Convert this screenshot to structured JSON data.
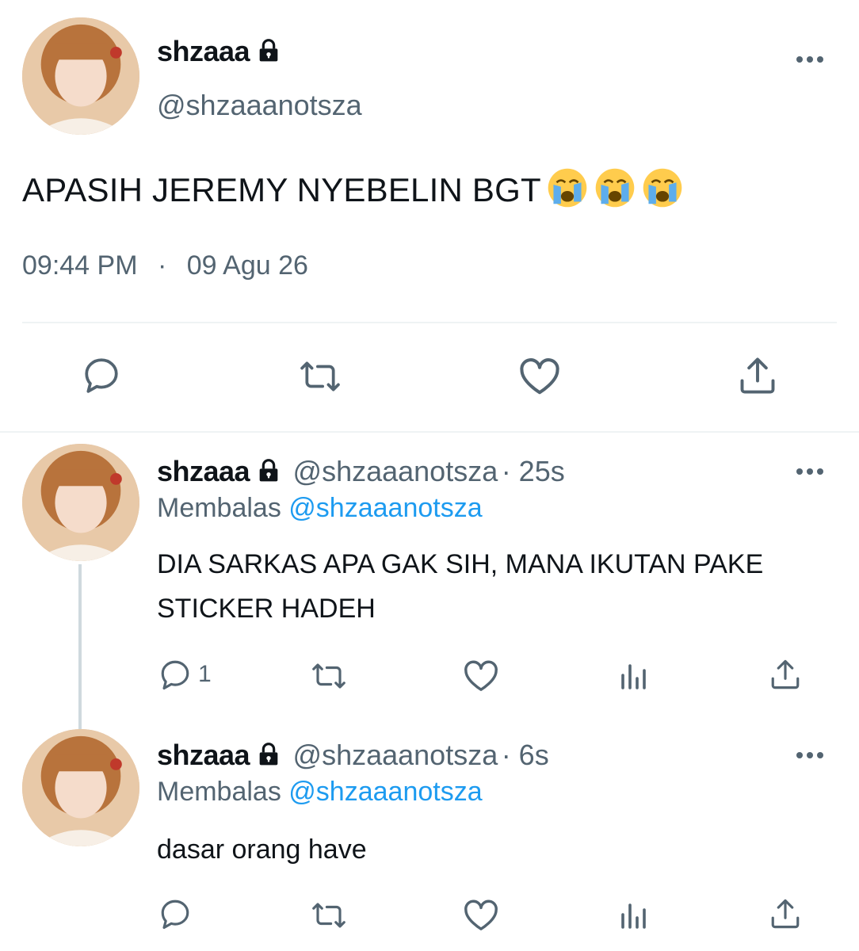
{
  "main_tweet": {
    "display_name": "shzaaa",
    "handle": "@shzaaanotsza",
    "text": "APASIH JEREMY NYEBELIN BGT",
    "emoji": [
      "loudly-crying-face",
      "loudly-crying-face",
      "loudly-crying-face"
    ],
    "time": "09:44 PM",
    "separator": "·",
    "date": "09 Agu 26",
    "actions": [
      "reply-icon",
      "retweet-icon",
      "like-icon",
      "share-icon"
    ]
  },
  "replies": [
    {
      "display_name": "shzaaa",
      "handle": "@shzaaanotsza",
      "age": "· 25s",
      "replying_prefix": "Membalas",
      "replying_to": "@shzaaanotsza",
      "text": "DIA SARKAS APA GAK SIH, MANA IKUTAN PAKE STICKER HADEH",
      "reply_count": "1"
    },
    {
      "display_name": "shzaaa",
      "handle": "@shzaaanotsza",
      "age": "· 6s",
      "replying_prefix": "Membalas",
      "replying_to": "@shzaaanotsza",
      "text": "dasar orang have",
      "reply_count": ""
    }
  ],
  "colors": {
    "primary_text": "#0f1419",
    "secondary_text": "#536471",
    "link": "#1d9bf0",
    "divider": "#eff3f4"
  }
}
